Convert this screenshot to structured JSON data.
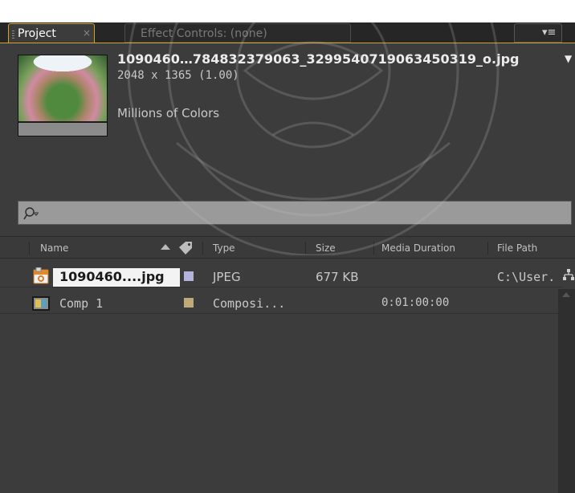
{
  "tabs": {
    "project": {
      "label": "Project",
      "close": "×"
    },
    "effect_controls": {
      "label": "Effect Controls: (none)"
    },
    "panel_menu": "▾≡"
  },
  "asset": {
    "name": "1090460…784832379063_3299540719063450319_o.jpg",
    "menu_arrow": "▼",
    "dimensions": "2048 x 1365 (1.00)",
    "colors": "Millions of Colors",
    "thumbnail": "fisheye-aerial-photo"
  },
  "search": {
    "value": "",
    "placeholder": ""
  },
  "columns": {
    "name": "Name",
    "type": "Type",
    "size": "Size",
    "media_duration": "Media Duration",
    "file_path": "File Path"
  },
  "rows": [
    {
      "icon": "jpg-file-icon",
      "name": "1090460....jpg",
      "label_color": "#b3b3dd",
      "type": "JPEG",
      "size": "677 KB",
      "media_duration": "",
      "file_path": "C:\\User."
    },
    {
      "icon": "composition-icon",
      "name": "Comp 1",
      "label_color": "#bfa97a",
      "type": "Composi...",
      "size": "",
      "media_duration": "0:01:00:00",
      "file_path": ""
    }
  ],
  "colors": {
    "accent": "#d9a21c",
    "panel_bg": "#3c3c3c",
    "selection_bg": "#f3f3f3"
  }
}
